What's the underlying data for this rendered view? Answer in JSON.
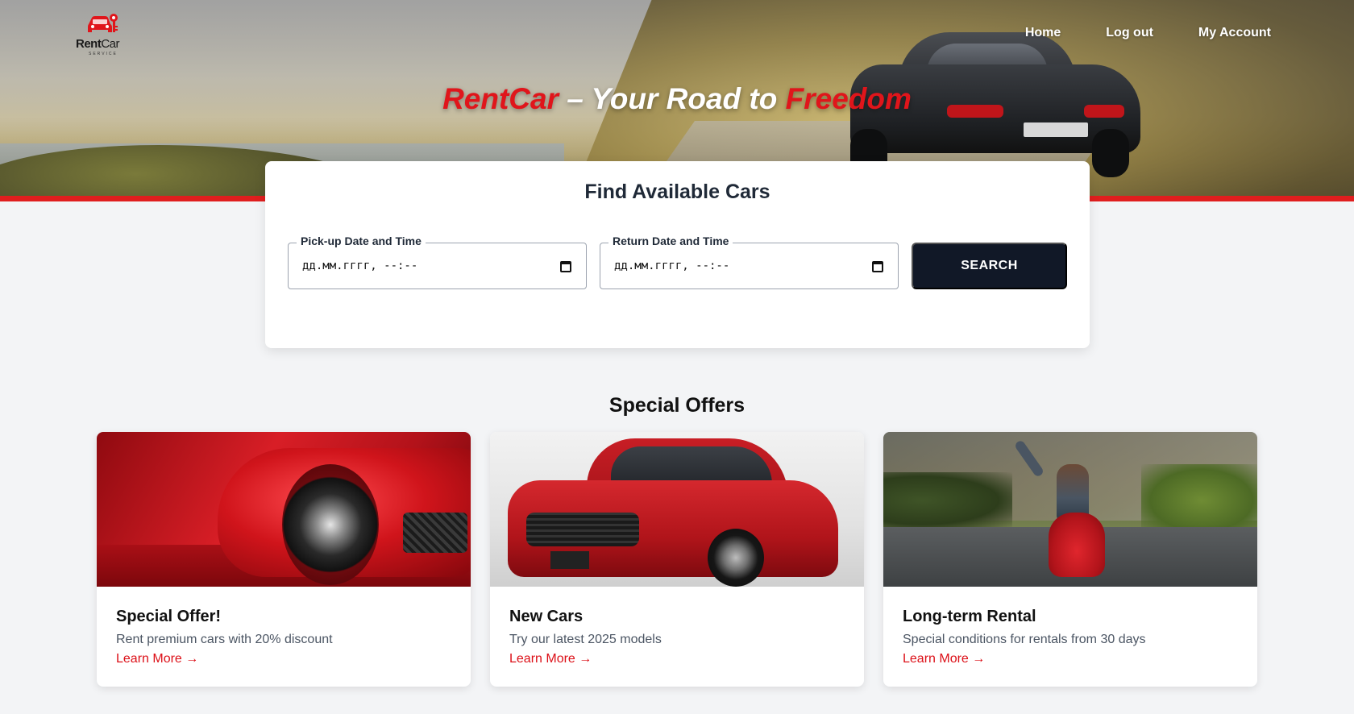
{
  "brand": {
    "logo_word_rent": "Rent",
    "logo_word_car": "Car",
    "logo_sub": "SERVICE"
  },
  "nav": {
    "items": [
      {
        "label": "Home"
      },
      {
        "label": "Log out"
      },
      {
        "label": "My Account"
      }
    ]
  },
  "hero": {
    "title_brand": "RentCar",
    "title_middle": " – Your Road to ",
    "title_end": "Freedom"
  },
  "search": {
    "title": "Find Available Cars",
    "pickup_label": "Pick-up Date and Time",
    "pickup_value": "дд.мм.гггг, --:--",
    "return_label": "Return Date and Time",
    "return_value": "дд.мм.гггг, --:--",
    "button_label": "SEARCH"
  },
  "offers": {
    "title": "Special Offers",
    "cards": [
      {
        "title": "Special Offer!",
        "description": "Rent premium cars with 20% discount",
        "link": "Learn More →"
      },
      {
        "title": "New Cars",
        "description": "Try our latest 2025 models",
        "link": "Learn More →"
      },
      {
        "title": "Long-term Rental",
        "description": "Special conditions for rentals from 30 days",
        "link": "Learn More →"
      }
    ]
  },
  "colors": {
    "accent_red": "#e0151b",
    "dark_button": "#111827",
    "page_bg": "#f3f4f6"
  }
}
